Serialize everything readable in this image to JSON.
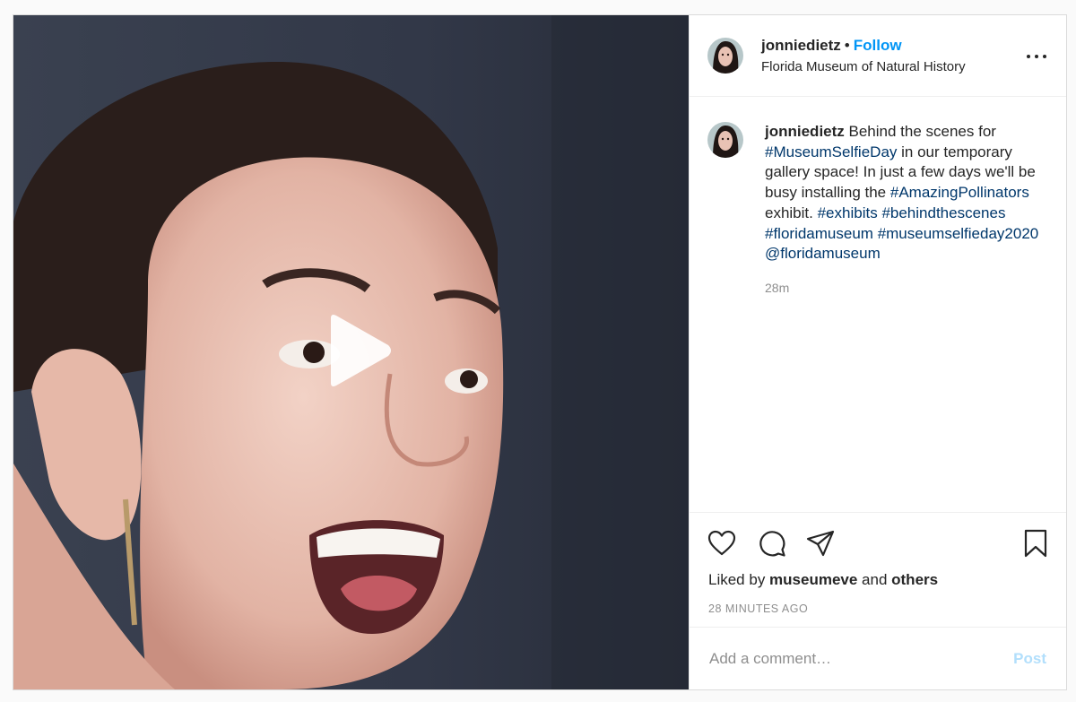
{
  "header": {
    "username": "jonniedietz",
    "separator": "•",
    "follow_label": "Follow",
    "location": "Florida Museum of Natural History"
  },
  "caption": {
    "username": "jonniedietz",
    "text_1": " Behind the scenes for ",
    "tag_1": "#MuseumSelfieDay",
    "text_2": " in our temporary gallery space! In just a few days we'll be busy installing the ",
    "tag_2": "#AmazingPollinators",
    "text_3": " exhibit. ",
    "tag_3": "#exhibits",
    "tag_4": "#behindthescenes",
    "tag_5": "#floridamuseum",
    "tag_6": "#museumselfieday2020",
    "mention_1": "@floridamuseum",
    "time": "28m"
  },
  "likes": {
    "prefix": "Liked by ",
    "user": "museumeve",
    "middle": " and ",
    "others": "others"
  },
  "timestamp": "28 MINUTES AGO",
  "comment": {
    "placeholder": "Add a comment…",
    "post_label": "Post"
  },
  "icons": [
    "play-icon",
    "more-options-icon",
    "heart-icon",
    "comment-icon",
    "share-icon",
    "bookmark-icon"
  ],
  "colors": {
    "accent": "#0095f6",
    "hashtag": "#00376b",
    "post_disabled": "#b2dffc",
    "muted": "#8e8e8e"
  }
}
